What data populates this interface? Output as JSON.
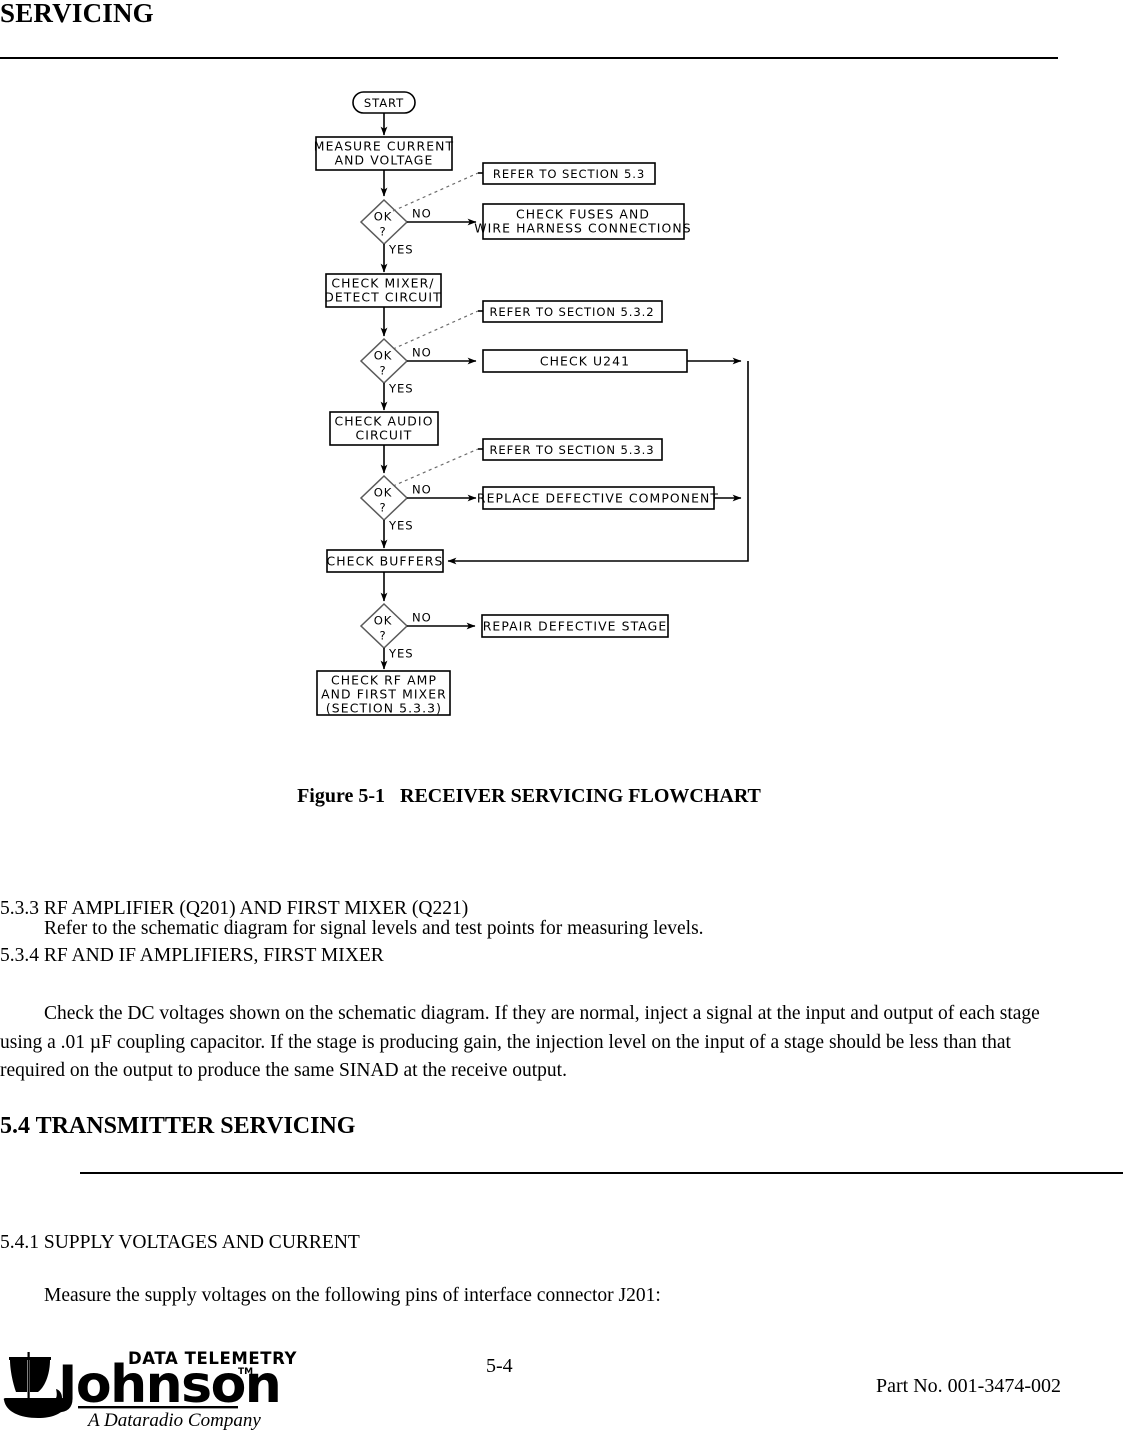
{
  "running_head": "SERVICING",
  "figure": {
    "caption": "Figure 5-1   RECEIVER SERVICING FLOWCHART",
    "type": "flowchart",
    "nodes": {
      "start": "START",
      "measure": "MEASURE CURRENT\nAND VOLTAGE",
      "measure_l1": "MEASURE CURRENT",
      "measure_l2": "AND VOLTAGE",
      "refer_53": "REFER TO SECTION 5.3",
      "check_fuses_l1": "CHECK FUSES AND",
      "check_fuses_l2": "WIRE HARNESS CONNECTIONS",
      "check_mixer_l1": "CHECK MIXER/",
      "check_mixer_l2": "DETECT CIRCUIT",
      "refer_532": "REFER TO SECTION 5.3.2",
      "check_u241": "CHECK U241",
      "check_audio_l1": "CHECK AUDIO",
      "check_audio_l2": "CIRCUIT",
      "refer_533": "REFER TO SECTION 5.3.3",
      "replace_component": "REPLACE DEFECTIVE COMPONENT",
      "check_buffers": "CHECK BUFFERS",
      "repair_stage": "REPAIR DEFECTIVE STAGE",
      "check_rf_l1": "CHECK RF AMP",
      "check_rf_l2": "AND FIRST MIXER",
      "check_rf_l3": "(SECTION 5.3.3)",
      "decision_l1": "OK",
      "decision_l2": "?",
      "branch_no": "NO",
      "branch_yes": "YES"
    }
  },
  "sections": {
    "s533_head": "5.3.3  RF AMPLIFIER (Q201) AND FIRST MIXER (Q221)",
    "s533_body": "Refer to the schematic diagram for signal levels and test points for measuring levels.",
    "s534_head": "5.3.4  RF AND IF AMPLIFIERS, FIRST MIXER",
    "s534_body": "Check the DC voltages shown on the schematic diagram. If they are normal, inject a signal at the input and output of each stage using a .01 µF coupling capacitor. If the stage is producing gain, the injection level on the input of a stage should be less than that required on the output to produce the same SINAD at the receive output.",
    "s54_head": "5.4 TRANSMITTER SERVICING",
    "s541_head": "5.4.1  SUPPLY VOLTAGES AND CURRENT",
    "s541_body": "Measure the supply voltages on the following pins of interface connector J201:"
  },
  "footer": {
    "logo_top": "DATA TELEMETRY",
    "logo_main": "Johnson",
    "logo_tm": "TM",
    "logo_tagline": "A Dataradio Company",
    "page_number": "5-4",
    "part_number": "Part No. 001-3474-002"
  }
}
